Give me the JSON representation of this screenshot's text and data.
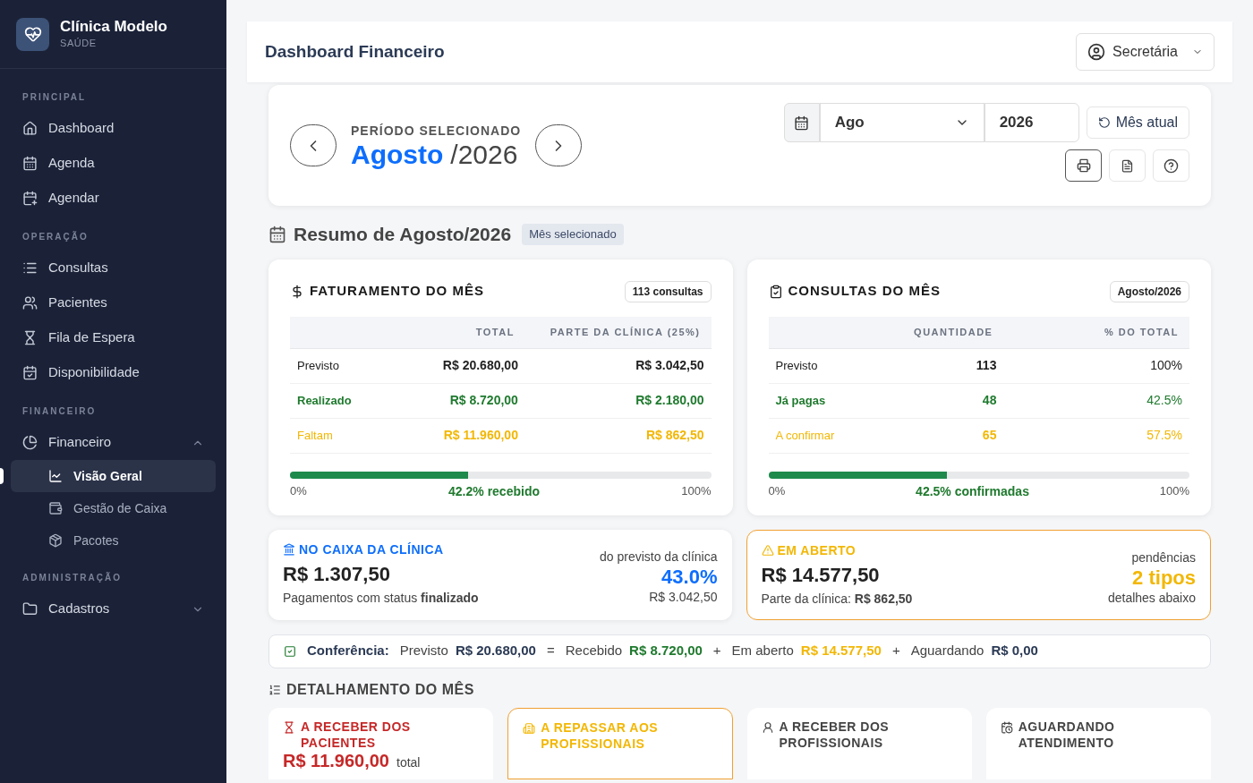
{
  "brand": {
    "name": "Clínica Modelo",
    "subtitle": "SAÚDE"
  },
  "sidebar": [
    {
      "title": "PRINCIPAL",
      "items": [
        {
          "label": "Dashboard",
          "selected": false
        },
        {
          "label": "Agenda",
          "selected": false
        },
        {
          "label": "Agendar",
          "selected": false
        }
      ]
    },
    {
      "title": "OPERAÇÃO",
      "items": [
        {
          "label": "Consultas",
          "selected": false
        },
        {
          "label": "Pacientes",
          "selected": false
        },
        {
          "label": "Fila de Espera",
          "selected": false
        },
        {
          "label": "Disponibilidade",
          "selected": false
        }
      ]
    },
    {
      "title": "FINANCEIRO",
      "items": [
        {
          "label": "Financeiro",
          "selected": false,
          "expanded": true,
          "children": [
            {
              "label": "Visão Geral",
              "selected": true
            },
            {
              "label": "Gestão de Caixa",
              "selected": false
            },
            {
              "label": "Pacotes",
              "selected": false
            }
          ]
        }
      ]
    },
    {
      "title": "ADMINISTRAÇÃO",
      "items": [
        {
          "label": "Cadastros",
          "selected": false,
          "expanded": false
        }
      ]
    }
  ],
  "header": {
    "title": "Dashboard Financeiro",
    "user": "Secretária"
  },
  "period": {
    "label": "PERÍODO SELECIONADO",
    "month": "Agosto",
    "year": "/2026",
    "month_select": "Ago",
    "year_value": "2026",
    "current_button": "Mês atual"
  },
  "summary": {
    "title": "Resumo de Agosto/2026",
    "badge": "Mês selecionado"
  },
  "cards": [
    {
      "title": "FATURAMENTO DO MÊS",
      "badge": "113 consultas",
      "columns": [
        "TOTAL",
        "PARTE DA CLÍNICA (25%)"
      ],
      "rows": [
        {
          "label": "Previsto",
          "color": "#222222",
          "values": [
            "R$ 20.680,00",
            "R$ 3.042,50"
          ]
        },
        {
          "label": "Realizado",
          "color": "#1f7a2e",
          "values": [
            "R$ 8.720,00",
            "R$ 2.180,00"
          ]
        },
        {
          "label": "Faltam",
          "color": "#f2b705",
          "values": [
            "R$ 11.960,00",
            "R$ 862,50"
          ]
        }
      ],
      "level": 0.422,
      "min": "0%",
      "progress": "42.2% recebido",
      "max": "100%"
    },
    {
      "title": "CONSULTAS DO MÊS",
      "badge": "Agosto/2026",
      "columns": [
        "QUANTIDADE",
        "% DO TOTAL"
      ],
      "rows": [
        {
          "label": "Previsto",
          "color": "#222222",
          "values": [
            "113",
            "100%"
          ]
        },
        {
          "label": "Já pagas",
          "color": "#1f7a2e",
          "values": [
            "48",
            "42.5%"
          ]
        },
        {
          "label": "A confirmar",
          "color": "#f2b705",
          "values": [
            "65",
            "57.5%"
          ]
        }
      ],
      "level": 0.425,
      "min": "0%",
      "progress": "42.5% confirmadas",
      "max": "100%"
    }
  ],
  "stats": [
    {
      "title": "NO CAIXA DA CLÍNICA",
      "color": "#0d6efd",
      "highlighted": false,
      "amount": "R$ 1.307,50",
      "note": "Pagamentos com status **finalizado**",
      "side_top": "do previsto da clínica",
      "side_value": "43.0%",
      "side_bottom": "R$ 3.042,50"
    },
    {
      "title": "EM ABERTO",
      "color": "#f2b705",
      "highlighted": true,
      "amount": "R$ 14.577,50",
      "note": "Parte da clínica: **R$ 862,50**",
      "side_top": "pendências",
      "side_value": "2 tipos",
      "side_bottom": "detalhes abaixo"
    }
  ],
  "check": {
    "label": "Conferência:",
    "items": [
      {
        "label": "Previsto",
        "value": "R$ 20.680,00",
        "color": "#2b3a55"
      },
      {
        "op": "=",
        "label": "Recebido",
        "value": "R$ 8.720,00",
        "color": "#1f7a2e"
      },
      {
        "op": "+",
        "label": "Em aberto",
        "value": "R$ 14.577,50",
        "color": "#f2b705"
      },
      {
        "op": "+",
        "label": "Aguardando",
        "value": "R$ 0,00",
        "color": "#2b3a55"
      }
    ]
  },
  "details": {
    "title": "DETALHAMENTO DO MÊS",
    "cards": [
      {
        "title": "A RECEBER DOS PACIENTES",
        "color": "#c62828",
        "highlighted": false,
        "amount": "R$ 11.960,00",
        "suffix": "total"
      },
      {
        "title": "A REPASSAR AOS PROFISSIONAIS",
        "color": "#f2b705",
        "highlighted": true
      },
      {
        "title": "A RECEBER DOS PROFISSIONAIS",
        "color": "#444444",
        "highlighted": false
      },
      {
        "title": "AGUARDANDO ATENDIMENTO",
        "color": "#444444",
        "highlighted": false
      }
    ]
  }
}
